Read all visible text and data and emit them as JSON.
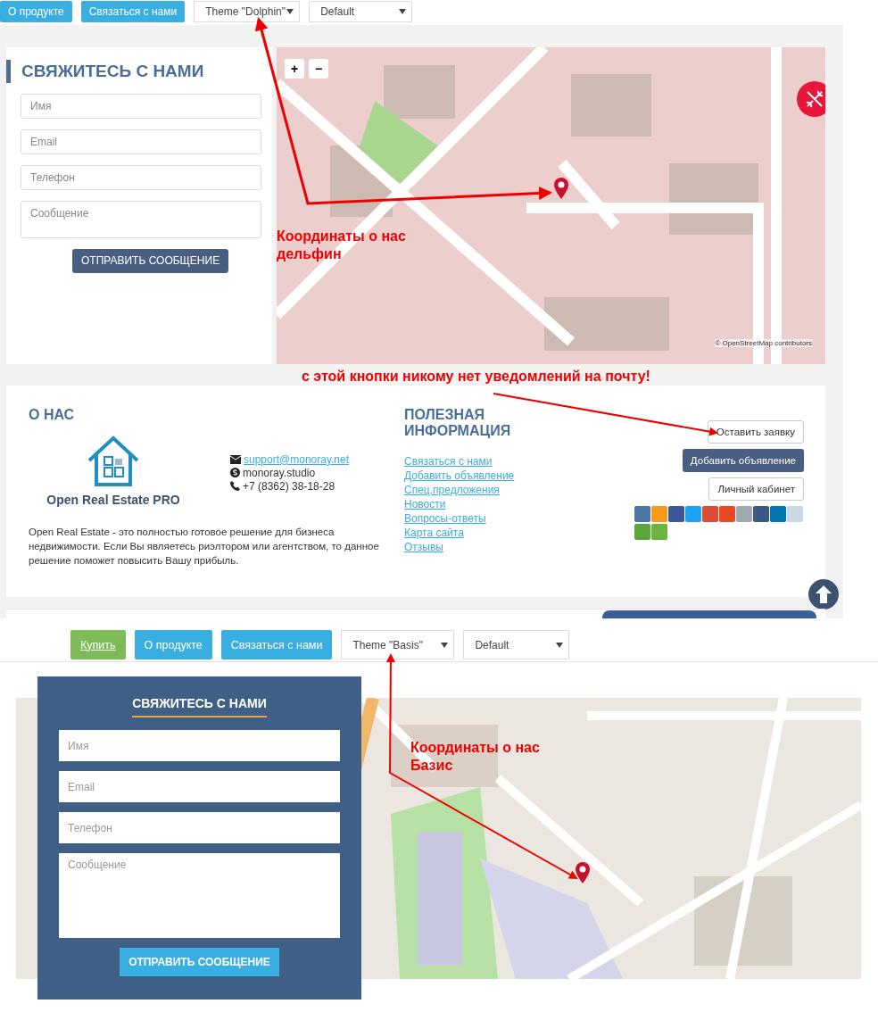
{
  "dolphin": {
    "toolbar": {
      "buttons": [
        {
          "label": "О продукте",
          "kind": "info"
        },
        {
          "label": "Связаться с нами",
          "kind": "info"
        }
      ],
      "selects": [
        "Theme \"Dolphin\"",
        "Default"
      ]
    },
    "contact_form": {
      "title": "СВЯЖИТЕСЬ С НАМИ",
      "fields": [
        {
          "placeholder": "Имя",
          "kind": "input"
        },
        {
          "placeholder": "Email",
          "kind": "input"
        },
        {
          "placeholder": "Телефон",
          "kind": "input"
        },
        {
          "placeholder": "Сообщение",
          "kind": "textarea"
        }
      ],
      "submit": "ОТПРАВИТЬ СООБЩЕНИЕ"
    },
    "map": {
      "zoom_in": "+",
      "zoom_out": "−",
      "attribution": "© OpenStreetMap contributors"
    },
    "about": {
      "title": "О НАС",
      "logo_text": "Open Real Estate PRO",
      "contacts": [
        {
          "kind": "email",
          "text": "support@monoray.net"
        },
        {
          "kind": "skype",
          "text": "monoray.studio"
        },
        {
          "kind": "phone",
          "text": "+7 (8362) 38-18-28"
        }
      ],
      "description": "Open Real Estate - это полностью готовое решение для бизнеса недвижимости. Если Вы являетесь риэлтором или агентством, то данное решение поможет повысить Вашу прибыль."
    },
    "useful": {
      "title": "ПОЛЕЗНАЯ ИНФОРМАЦИЯ",
      "links": [
        "Связаться с нами",
        "Добавить объявление",
        "Спец.предложения",
        "Новости",
        "Вопросы-ответы",
        "Карта сайта",
        "Отзывы"
      ]
    },
    "actions": [
      {
        "label": "Оставить заявку",
        "kind": "outline"
      },
      {
        "label": "Добавить объявление",
        "kind": "primary"
      },
      {
        "label": "Личный кабинет",
        "kind": "outline"
      }
    ]
  },
  "basis": {
    "toolbar": {
      "buttons": [
        {
          "label": "Купить",
          "kind": "buy"
        },
        {
          "label": "О продукте",
          "kind": "info"
        },
        {
          "label": "Связаться с нами",
          "kind": "info"
        }
      ],
      "selects": [
        "Theme \"Basis\"",
        "Default"
      ]
    },
    "contact_form": {
      "title": "СВЯЖИТЕСЬ С НАМИ",
      "fields": [
        {
          "placeholder": "Имя",
          "kind": "input"
        },
        {
          "placeholder": "Email",
          "kind": "input"
        },
        {
          "placeholder": "Телефон",
          "kind": "input"
        },
        {
          "placeholder": "Сообщение",
          "kind": "textarea"
        }
      ],
      "submit": "ОТПРАВИТЬ СООБЩЕНИЕ"
    }
  },
  "annotations": [
    {
      "kind": "dolphin-map",
      "lines": [
        "Координаты о нас",
        "дельфин"
      ]
    },
    {
      "kind": "footer-button",
      "lines": [
        "с этой кнопки никому нет уведомлений на почту!"
      ]
    },
    {
      "kind": "basis-map",
      "lines": [
        "Координаты о нас",
        "Базис"
      ]
    }
  ]
}
